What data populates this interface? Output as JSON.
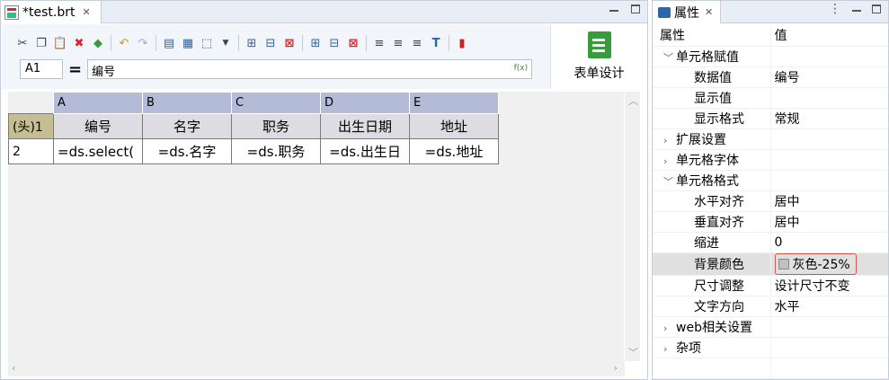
{
  "editor": {
    "tab_title": "*test.brt",
    "formula": {
      "cell_ref": "A1",
      "equals": "=",
      "value": "编号",
      "fx": "f(x)"
    },
    "design_button": "表单设计",
    "sheet": {
      "columns": [
        "A",
        "B",
        "C",
        "D",
        "E"
      ],
      "rows": [
        {
          "header": "(头)1",
          "cells": [
            "编号",
            "名字",
            "职务",
            "出生日期",
            "地址"
          ]
        },
        {
          "header": "2",
          "cells": [
            "=ds.select(",
            "=ds.名字",
            "=ds.职务",
            "=ds.出生日",
            "=ds.地址"
          ]
        }
      ]
    }
  },
  "toolbar_icons": [
    "cut-icon",
    "copy-icon",
    "paste-icon",
    "delete-icon",
    "eraser-icon",
    "undo-icon",
    "redo-icon",
    "merge-cells-icon",
    "table-icon",
    "border-icon",
    "dropdown-icon",
    "insert-row-icon",
    "insert-column-icon",
    "delete-row-icon",
    "add-row-icon",
    "add-column-icon",
    "remove-icon",
    "align-left-icon",
    "align-center-icon",
    "align-right-icon",
    "text-style-icon",
    "chart-icon"
  ],
  "props": {
    "tab_title": "属性",
    "header": {
      "name": "属性",
      "value": "值"
    },
    "rows": [
      {
        "type": "cat",
        "expanded": true,
        "name": "单元格赋值",
        "value": ""
      },
      {
        "type": "sub",
        "name": "数据值",
        "value": "编号"
      },
      {
        "type": "sub",
        "name": "显示值",
        "value": ""
      },
      {
        "type": "sub",
        "name": "显示格式",
        "value": "常规"
      },
      {
        "type": "cat",
        "expanded": false,
        "name": "扩展设置",
        "value": ""
      },
      {
        "type": "cat",
        "expanded": false,
        "name": "单元格字体",
        "value": ""
      },
      {
        "type": "cat",
        "expanded": true,
        "name": "单元格格式",
        "value": ""
      },
      {
        "type": "sub",
        "name": "水平对齐",
        "value": "居中"
      },
      {
        "type": "sub",
        "name": "垂直对齐",
        "value": "居中"
      },
      {
        "type": "sub",
        "name": "缩进",
        "value": "0"
      },
      {
        "type": "sub",
        "name": "背景颜色",
        "value": "灰色-25%"
      },
      {
        "type": "sub",
        "name": "尺寸调整",
        "value": "设计尺寸不变"
      },
      {
        "type": "sub",
        "name": "文字方向",
        "value": "水平"
      },
      {
        "type": "cat",
        "expanded": false,
        "name": "web相关设置",
        "value": ""
      },
      {
        "type": "cat",
        "expanded": false,
        "name": "杂项",
        "value": ""
      }
    ]
  },
  "colors": {
    "column_header": "#b4bbd6",
    "row1_header": "#c4be92",
    "header_cells": "#dcdce2",
    "highlight_border": "#d9534f"
  }
}
